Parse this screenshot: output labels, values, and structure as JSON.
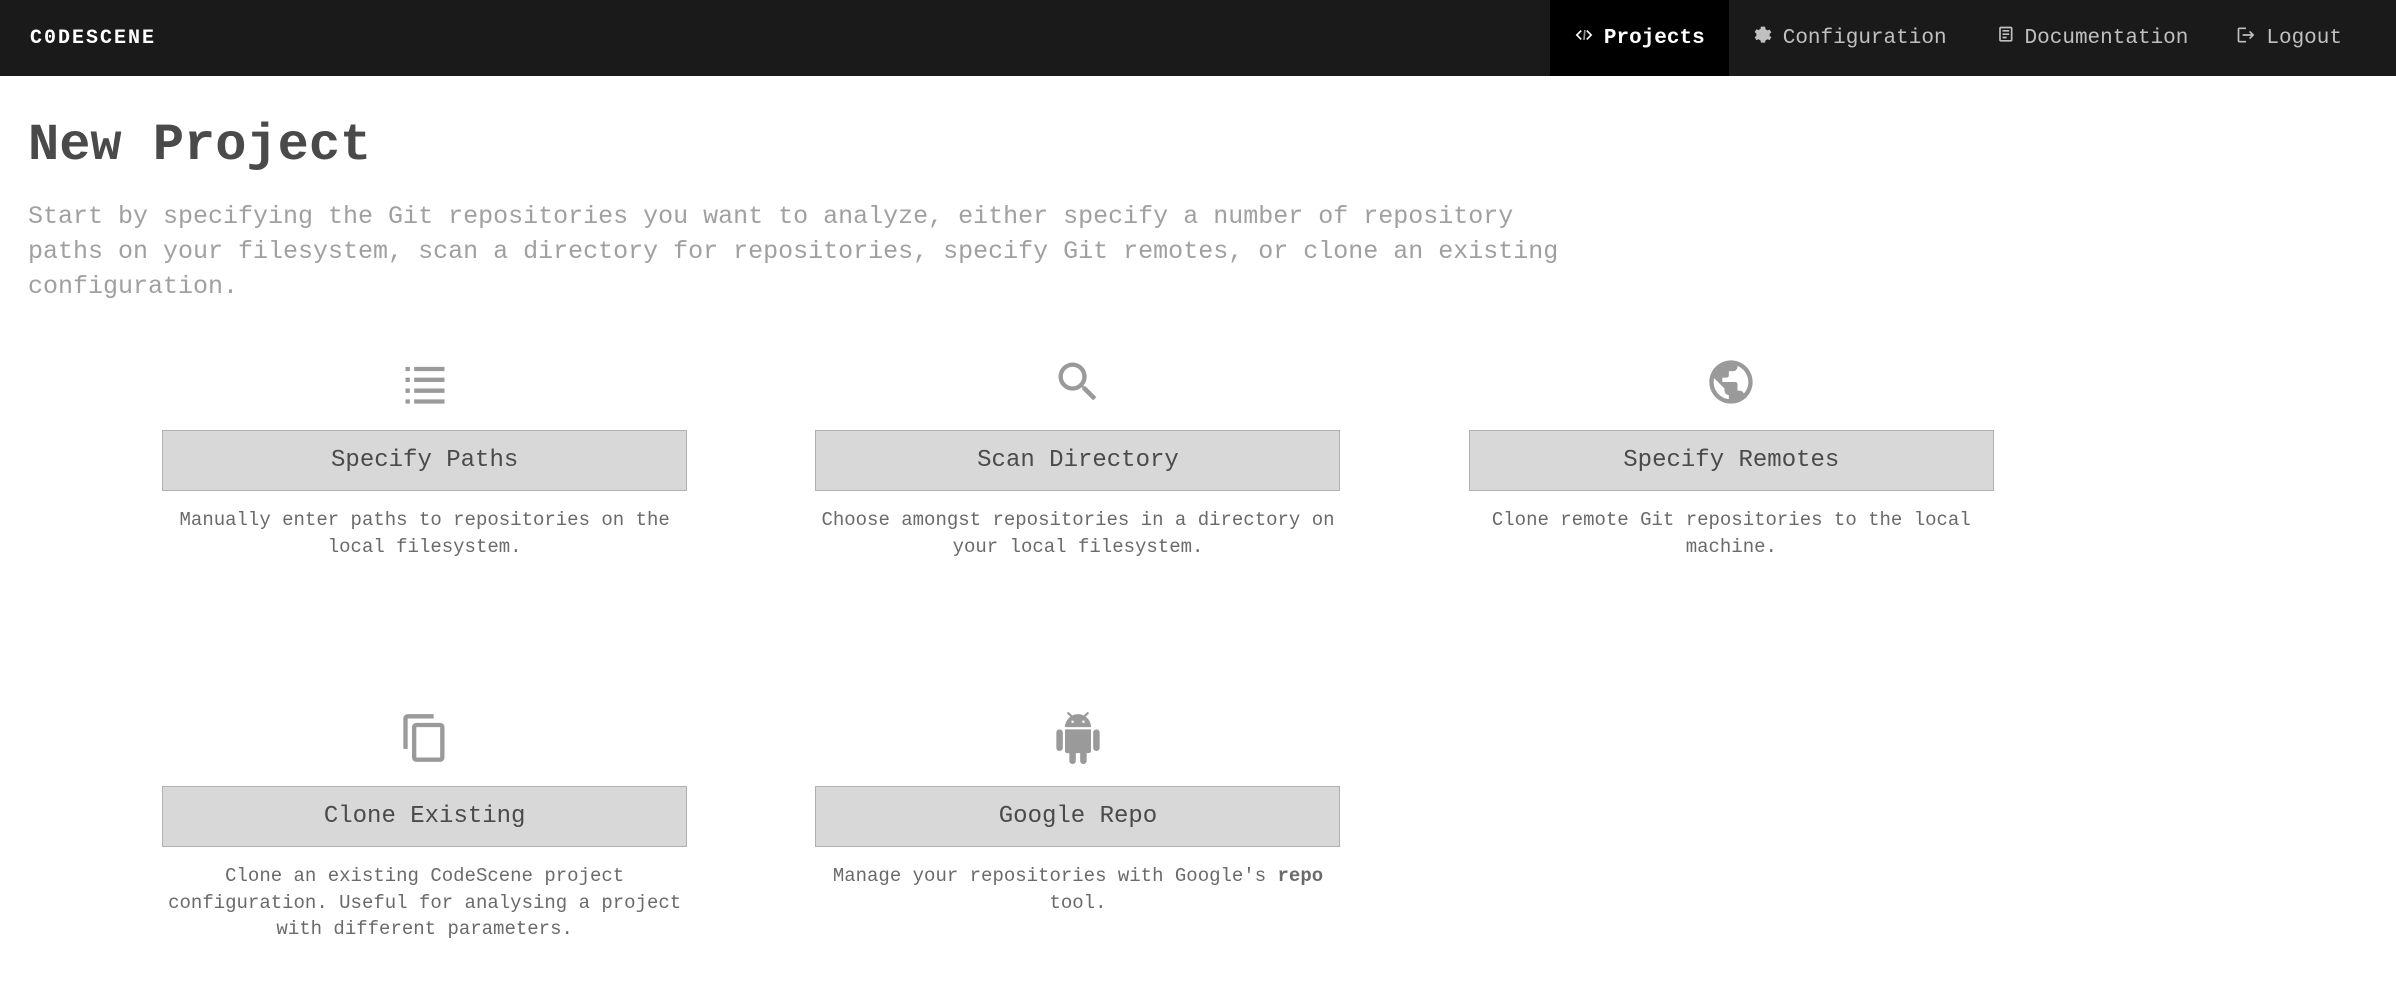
{
  "logo": "C0DESCENE",
  "nav": {
    "projects": "Projects",
    "configuration": "Configuration",
    "documentation": "Documentation",
    "logout": "Logout"
  },
  "page": {
    "title": "New Project",
    "description": "Start by specifying the Git repositories you want to analyze, either specify a number of repository paths on your filesystem, scan a directory for repositories, specify Git remotes, or clone an existing configuration."
  },
  "options": {
    "specify_paths": {
      "label": "Specify Paths",
      "description": "Manually enter paths to repositories on the local filesystem."
    },
    "scan_directory": {
      "label": "Scan Directory",
      "description": "Choose amongst repositories in a directory on your local filesystem."
    },
    "specify_remotes": {
      "label": "Specify Remotes",
      "description": "Clone remote Git repositories to the local machine."
    },
    "clone_existing": {
      "label": "Clone Existing",
      "description": "Clone an existing CodeScene project configuration. Useful for analysing a project with different parameters."
    },
    "google_repo": {
      "label": "Google Repo",
      "description_prefix": "Manage your repositories with Google's ",
      "description_bold": "repo",
      "description_suffix": " tool."
    }
  }
}
